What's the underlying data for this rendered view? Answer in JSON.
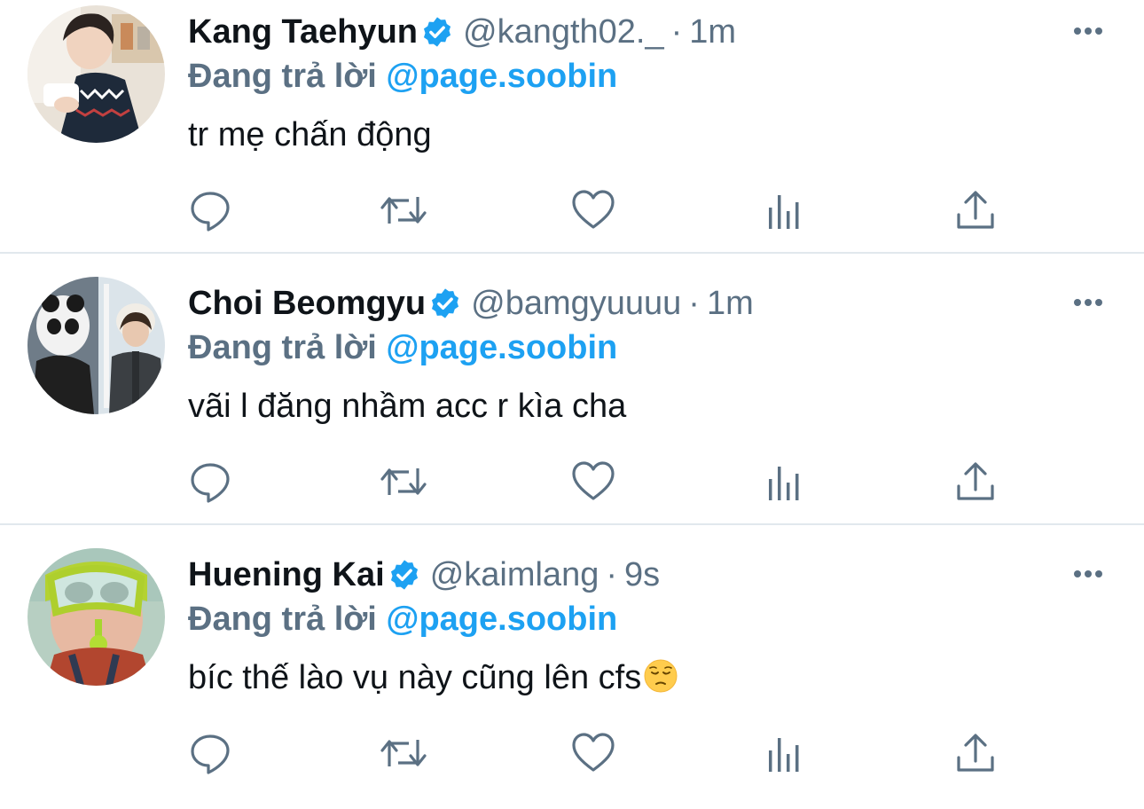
{
  "tweets": [
    {
      "name": "Kang Taehyun",
      "handle": "@kangth02._",
      "dot": "·",
      "time": "1m",
      "reply_prefix": "Đang trả lời",
      "reply_to": "@page.soobin",
      "text": "tr mẹ chấn động",
      "avatar_icon": "avatar-photo"
    },
    {
      "name": "Choi Beomgyu",
      "handle": "@bamgyuuuu",
      "dot": "·",
      "time": "1m",
      "reply_prefix": "Đang trả lời",
      "reply_to": "@page.soobin",
      "text": "vãi l đăng nhầm acc r kìa cha",
      "avatar_icon": "avatar-photo"
    },
    {
      "name": "Huening Kai",
      "handle": "@kaimlang",
      "dot": "·",
      "time": "9s",
      "reply_prefix": "Đang trả lời",
      "reply_to": "@page.soobin",
      "text": "bíc thế lào vụ này cũng lên cfs",
      "text_emoji": "pensive-face-emoji",
      "avatar_icon": "avatar-photo"
    }
  ],
  "icons": {
    "verified": "verified-badge-icon",
    "more": "more-options-icon",
    "reply": "reply-icon",
    "retweet": "retweet-icon",
    "like": "like-heart-icon",
    "analytics": "analytics-icon",
    "share": "share-icon"
  },
  "colors": {
    "link_blue": "#1da1f2",
    "secondary_gray": "#5b7083",
    "text_dark": "#0f1419",
    "divider": "#e1e8ed"
  }
}
